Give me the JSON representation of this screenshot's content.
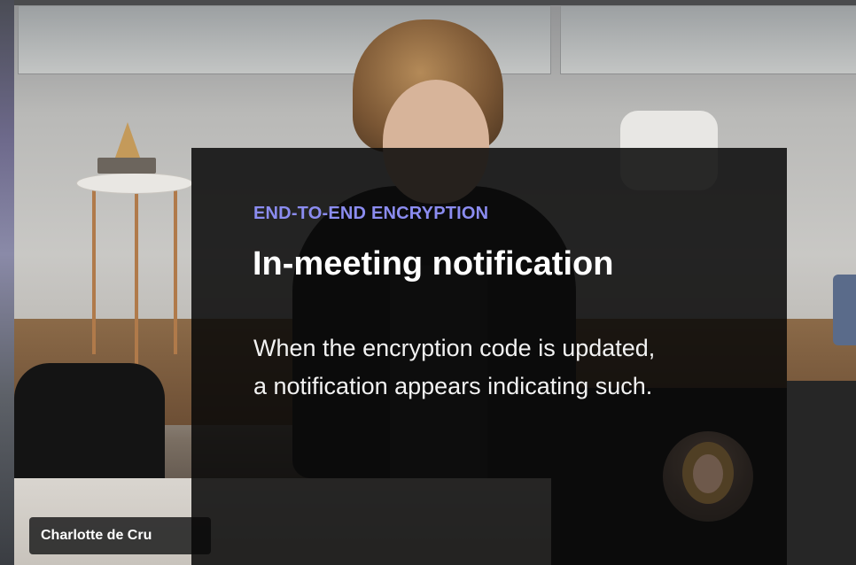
{
  "participant": {
    "name_tag": "Charlotte de Cru"
  },
  "overlay": {
    "eyebrow": "END-TO-END ENCRYPTION",
    "title": "In-meeting notification",
    "body": "When the encryption code is updated, a notification appears indicating such."
  },
  "colors": {
    "accent": "#8b8cf0",
    "overlay_background": "#080808",
    "title_text": "#ffffff",
    "name_tag_background": "#2a2a2a"
  },
  "icons": {
    "participant_avatar": "avatar-image"
  }
}
